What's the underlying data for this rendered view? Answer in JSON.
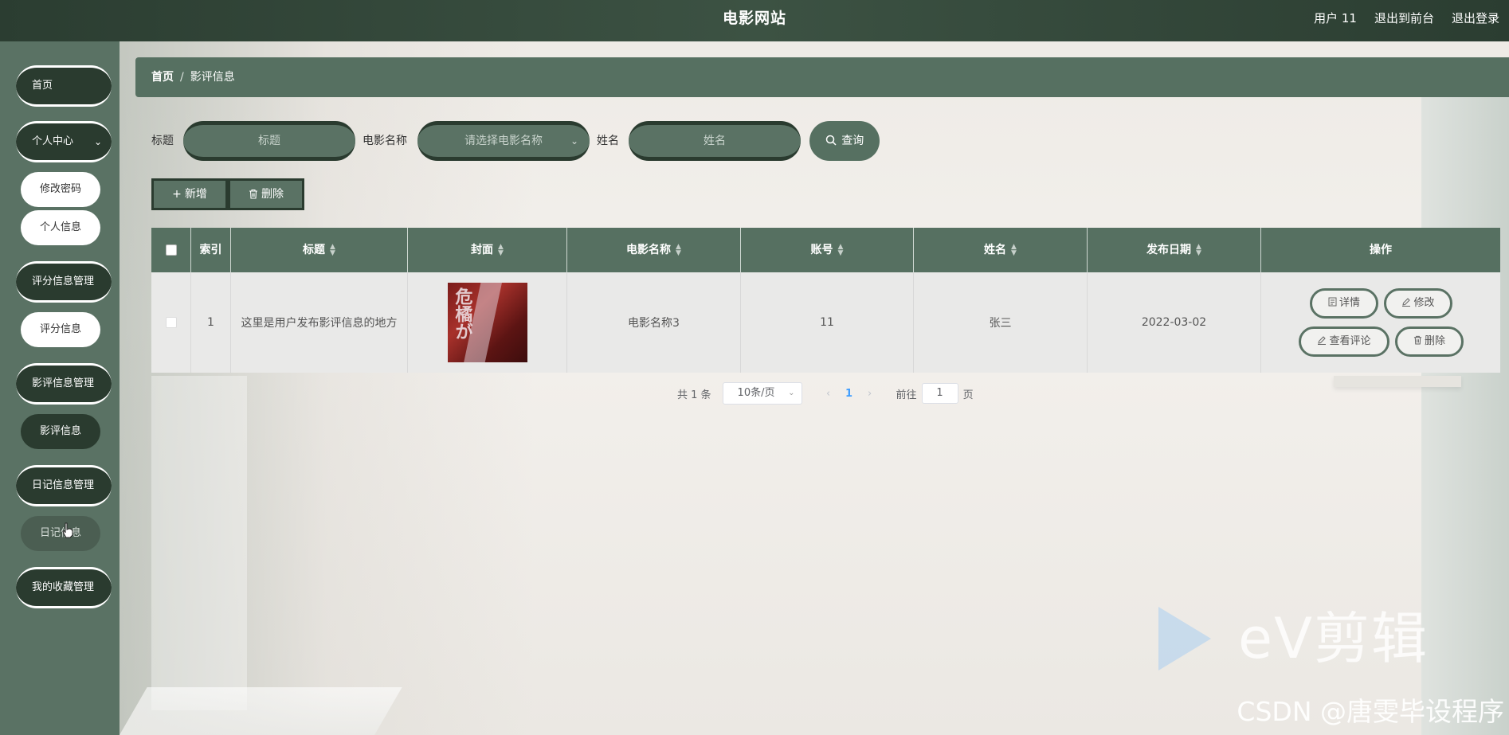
{
  "header": {
    "title": "电影网站",
    "user": "用户 11",
    "to_front": "退出到前台",
    "logout": "退出登录"
  },
  "sidebar": {
    "items": [
      {
        "label": "首页"
      },
      {
        "label": "个人中心"
      },
      {
        "label": "修改密码"
      },
      {
        "label": "个人信息"
      },
      {
        "label": "评分信息管理"
      },
      {
        "label": "评分信息"
      },
      {
        "label": "影评信息管理"
      },
      {
        "label": "影评信息"
      },
      {
        "label": "日记信息管理"
      },
      {
        "label": "日记信息"
      },
      {
        "label": "我的收藏管理"
      }
    ]
  },
  "breadcrumb": {
    "home": "首页",
    "sep": "/",
    "current": "影评信息"
  },
  "search": {
    "title_label": "标题",
    "title_placeholder": "标题",
    "movie_label": "电影名称",
    "movie_placeholder": "请选择电影名称",
    "name_label": "姓名",
    "name_placeholder": "姓名",
    "query_button": "查询"
  },
  "actions": {
    "add": "新增",
    "delete": "删除"
  },
  "table": {
    "columns": [
      "索引",
      "标题",
      "封面",
      "电影名称",
      "账号",
      "姓名",
      "发布日期",
      "操作"
    ],
    "rows": [
      {
        "index": "1",
        "title": "这里是用户发布影评信息的地方",
        "cover_text": "危橘が",
        "movie": "电影名称3",
        "account": "11",
        "name": "张三",
        "date": "2022-03-02",
        "ops": {
          "detail": "详情",
          "edit": "修改",
          "comments": "查看评论",
          "delete": "删除"
        }
      }
    ]
  },
  "pagination": {
    "total": "共 1 条",
    "page_size": "10条/页",
    "current_page": "1",
    "goto_label": "前往",
    "goto_value": "1",
    "page_suffix": "页"
  },
  "watermarks": {
    "ev": "eV剪辑",
    "csdn": "CSDN @唐雯毕设程序"
  }
}
